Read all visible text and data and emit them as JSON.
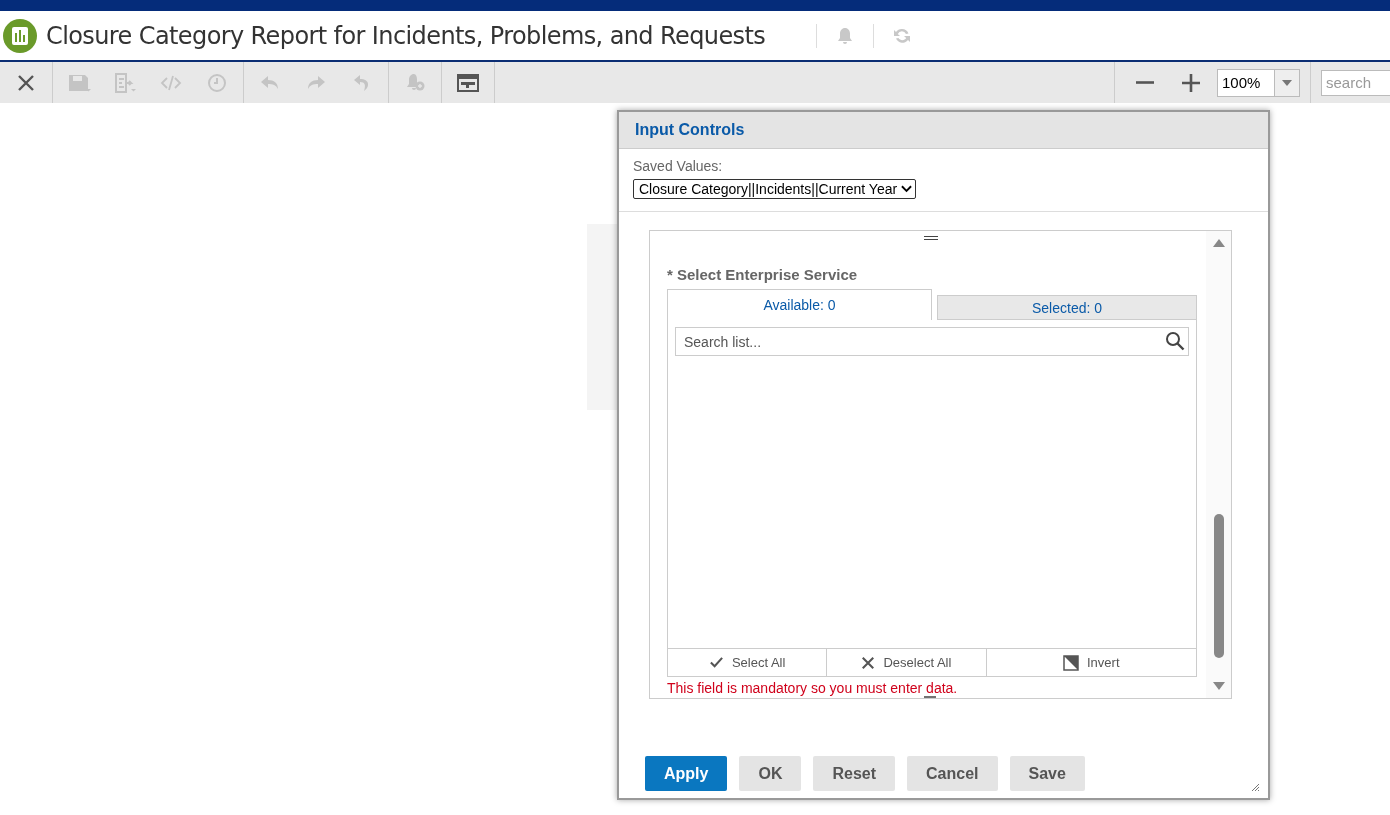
{
  "header": {
    "title": "Closure Category Report for Incidents, Problems, and Requests"
  },
  "toolbar": {
    "buttons": [
      {
        "kind": "close",
        "disabled": false
      },
      {
        "kind": "save",
        "disabled": true
      },
      {
        "kind": "export",
        "disabled": true
      },
      {
        "kind": "code",
        "disabled": true
      },
      {
        "kind": "schedule",
        "disabled": true
      },
      {
        "kind": "undo",
        "disabled": true
      },
      {
        "kind": "redo",
        "disabled": true
      },
      {
        "kind": "undo-all",
        "disabled": true
      },
      {
        "kind": "alert",
        "disabled": true
      },
      {
        "kind": "controls",
        "disabled": false
      }
    ],
    "zoom": "100%",
    "search_placeholder": "search"
  },
  "dialog": {
    "title": "Input Controls",
    "saved_values_label": "Saved Values:",
    "saved_value": "Closure Category||Incidents||Current Year",
    "control": {
      "label": "* Select Enterprise Service",
      "tabs": [
        {
          "label": "Available: 0",
          "selected": true
        },
        {
          "label": "Selected: 0",
          "selected": false
        }
      ],
      "search_placeholder": "Search list...",
      "actions": [
        {
          "kind": "select",
          "label": "Select All"
        },
        {
          "kind": "deselect",
          "label": "Deselect All"
        },
        {
          "kind": "invert",
          "label": "Invert"
        }
      ],
      "error": "This field is mandatory so you must enter data."
    },
    "buttons": [
      {
        "label": "Apply",
        "kind": "primary"
      },
      {
        "label": "OK",
        "kind": "default"
      },
      {
        "label": "Reset",
        "kind": "default"
      },
      {
        "label": "Cancel",
        "kind": "default"
      },
      {
        "label": "Save",
        "kind": "default"
      }
    ]
  }
}
